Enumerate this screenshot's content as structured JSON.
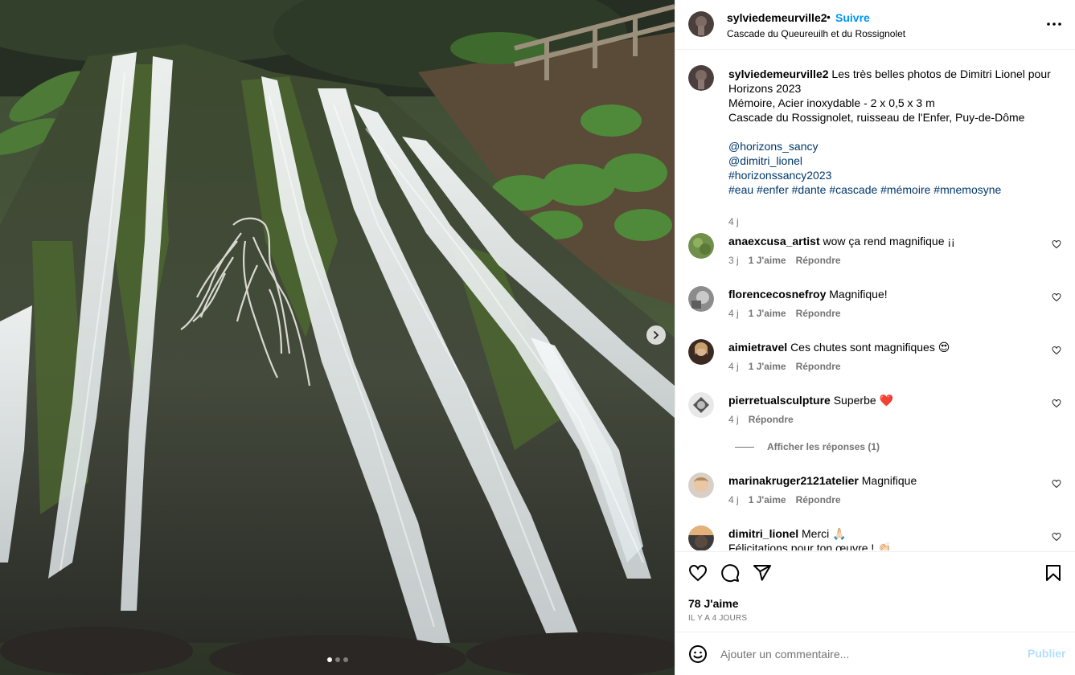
{
  "post": {
    "author": "sylviedemeurville2",
    "separator": "•",
    "follow_label": "Suivre",
    "location": "Cascade du Queureuilh et du Rossignolet",
    "more_icon": "more-options-icon"
  },
  "media": {
    "description_icon": "waterfall-photo",
    "next_icon": "chevron-right-icon",
    "slides": {
      "count": 3,
      "active_index": 0
    }
  },
  "caption": {
    "author": "sylviedemeurville2",
    "lines": [
      "Les très belles photos de Dimitri Lionel pour",
      "Horizons 2023",
      "Mémoire, Acier inoxydable - 2 x 0,5 x 3 m",
      "Cascade du Rossignolet, ruisseau de l'Enfer, Puy-de-Dôme"
    ],
    "tags": [
      "@horizons_sancy",
      "@dimitri_lionel",
      "#horizonssancy2023",
      "#eau #enfer #dante #cascade #mémoire #mnemosyne"
    ],
    "time": "4 j"
  },
  "comments": [
    {
      "user": "anaexcusa_artist",
      "text": "wow ça rend magnifique ¡¡",
      "time": "3 j",
      "likes": "1 J'aime",
      "reply": "Répondre"
    },
    {
      "user": "florencecosnefroy",
      "text": "Magnifique!",
      "time": "4 j",
      "likes": "1 J'aime",
      "reply": "Répondre"
    },
    {
      "user": "aimietravel",
      "text": "Ces chutes sont magnifiques 😍",
      "time": "4 j",
      "likes": "1 J'aime",
      "reply": "Répondre"
    },
    {
      "user": "pierretualsculpture",
      "text": "Superbe ❤️",
      "time": "4 j",
      "likes": "",
      "reply": "Répondre"
    },
    {
      "user": "marinakruger2121atelier",
      "text": "Magnifique",
      "time": "4 j",
      "likes": "1 J'aime",
      "reply": "Répondre"
    },
    {
      "user": "dimitri_lionel",
      "text": "Merci 🙏🏻",
      "text2": "Félicitations pour ton œuvre ! 👏🏻",
      "time": "",
      "likes": "",
      "reply": ""
    }
  ],
  "view_replies_label": "Afficher les réponses (1)",
  "actions": {
    "like_icon": "heart-icon",
    "comment_icon": "comment-icon",
    "share_icon": "share-icon",
    "save_icon": "bookmark-icon",
    "likes_count": "78 J'aime",
    "date": "IL Y A 4 JOURS"
  },
  "add_comment": {
    "emoji_icon": "emoji-icon",
    "placeholder": "Ajouter un commentaire...",
    "publish_label": "Publier"
  },
  "colors": {
    "accent": "#0095f6",
    "link": "#00376b",
    "secondary_text": "#737373",
    "publish_disabled": "#b2dffc",
    "heart_red": "#ed4956"
  }
}
